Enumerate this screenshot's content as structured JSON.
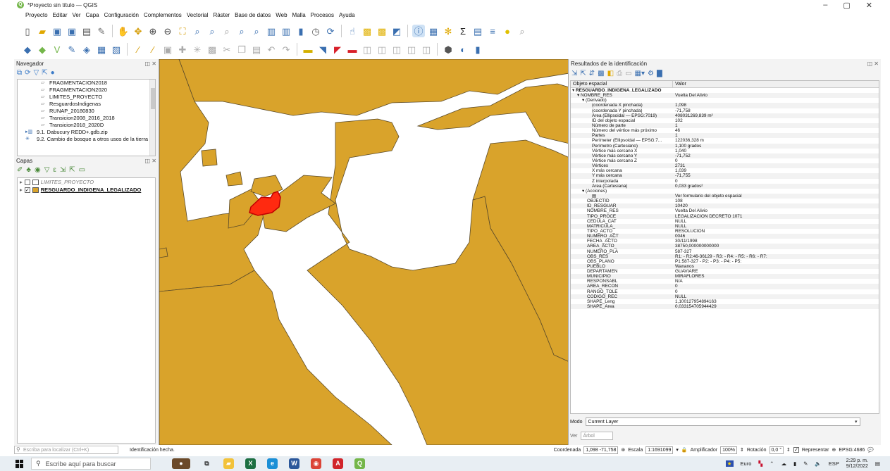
{
  "window": {
    "title": "*Proyecto sin título — QGIS",
    "controls": [
      "–",
      "▢",
      "✕"
    ]
  },
  "menu": [
    "Proyecto",
    "Editar",
    "Ver",
    "Capa",
    "Configuración",
    "Complementos",
    "Vectorial",
    "Ráster",
    "Base de datos",
    "Web",
    "Malla",
    "Procesos",
    "Ayuda"
  ],
  "navigator": {
    "title": "Navegador",
    "items": [
      {
        "label": "FRAGMENTACION2018",
        "indent": 3,
        "icon": "vector-layer-icon"
      },
      {
        "label": "FRAGMENTACION2020",
        "indent": 3,
        "icon": "vector-layer-icon"
      },
      {
        "label": "LIMITES_PROYECTO",
        "indent": 3,
        "icon": "vector-layer-icon"
      },
      {
        "label": "ResguardosIndigenas",
        "indent": 3,
        "icon": "vector-layer-icon"
      },
      {
        "label": "RUNAP_20180830",
        "indent": 3,
        "icon": "vector-layer-icon"
      },
      {
        "label": "Transicion2008_2016_2018",
        "indent": 3,
        "icon": "vector-layer-icon"
      },
      {
        "label": "Transicion2018_2020D",
        "indent": 3,
        "icon": "vector-layer-icon"
      },
      {
        "label": "9.1. Dabucury REDD+.gdb.zip",
        "indent": 1,
        "icon": "zip-icon"
      },
      {
        "label": "9.2. Cambio de bosque a otros usos de la tierra",
        "indent": 1,
        "icon": "folder-icon"
      }
    ]
  },
  "layers": {
    "title": "Capas",
    "items": [
      {
        "label": "LIMITES_PROYECTO",
        "checked": false,
        "italic": true,
        "swatch": "#ffffff"
      },
      {
        "label": "RESGUARDO_INDIGENA_LEGALIZADO",
        "checked": true,
        "italic": false,
        "swatch": "#d9a32b"
      }
    ]
  },
  "map": {
    "fill": "#d9a32b",
    "stroke": "#5a4a2a",
    "highlight": "#ff2a10"
  },
  "results": {
    "title": "Resultados de la identificación",
    "col_feature": "Objeto espacial",
    "col_value": "Valor",
    "rows": [
      {
        "k": "▾ RESGUARDO_INDIGENA_LEGALIZADO",
        "v": "",
        "indent": 0,
        "bold": true
      },
      {
        "k": "▾ NOMBRE_RES",
        "v": "Vuelta Del Alivio",
        "indent": 1,
        "bold": false
      },
      {
        "k": "▾ (Derivado)",
        "v": "",
        "indent": 2,
        "bold": false
      },
      {
        "k": "(coordenada X pinchada)",
        "v": "1,098",
        "indent": 4,
        "bold": false
      },
      {
        "k": "(coordenada Y pinchada)",
        "v": "-71,758",
        "indent": 4,
        "bold": false
      },
      {
        "k": "Área (Ellipsoidal — EPSG:7019)",
        "v": "408031269,839 m²",
        "indent": 4,
        "bold": false
      },
      {
        "k": "ID del objeto espacial",
        "v": "102",
        "indent": 4,
        "bold": false
      },
      {
        "k": "Número de parte",
        "v": "1",
        "indent": 4,
        "bold": false
      },
      {
        "k": "Número del vértice más próximo",
        "v": "46",
        "indent": 4,
        "bold": false
      },
      {
        "k": "Partes",
        "v": "1",
        "indent": 4,
        "bold": false
      },
      {
        "k": "Perímeter (Ellipsoidal — EPSG:7...",
        "v": "122036,328 m",
        "indent": 4,
        "bold": false
      },
      {
        "k": "Perímetro (Cartesiano)",
        "v": "1,100 grados",
        "indent": 4,
        "bold": false
      },
      {
        "k": "Vértice más cercano X",
        "v": "1,040",
        "indent": 4,
        "bold": false
      },
      {
        "k": "Vértice más cercano Y",
        "v": "-71,752",
        "indent": 4,
        "bold": false
      },
      {
        "k": "Vértice más cercano Z",
        "v": "0",
        "indent": 4,
        "bold": false
      },
      {
        "k": "Vértices",
        "v": "2731",
        "indent": 4,
        "bold": false
      },
      {
        "k": "X más cercana",
        "v": "1,039",
        "indent": 4,
        "bold": false
      },
      {
        "k": "Y más cercana",
        "v": "-71,755",
        "indent": 4,
        "bold": false
      },
      {
        "k": "Z interpolada",
        "v": "0",
        "indent": 4,
        "bold": false
      },
      {
        "k": "Área (Cartesiana)",
        "v": "0,033 grados²",
        "indent": 4,
        "bold": false
      },
      {
        "k": "▾ (Acciones)",
        "v": "",
        "indent": 2,
        "bold": false
      },
      {
        "k": "▤",
        "v": "Ver formulario del objeto espacial",
        "indent": 4,
        "bold": false
      },
      {
        "k": "OBJECTID",
        "v": "108",
        "indent": 3,
        "bold": false
      },
      {
        "k": "ID_RESGUAR",
        "v": "10420",
        "indent": 3,
        "bold": false
      },
      {
        "k": "NOMBRE_RES",
        "v": "Vuelta Del Alivio",
        "indent": 3,
        "bold": false
      },
      {
        "k": "TIPO_PROCE",
        "v": "LEGALIZACIÓN DECRETO 1071",
        "indent": 3,
        "bold": false
      },
      {
        "k": "CEDULA_CAT",
        "v": "NULL",
        "indent": 3,
        "bold": false
      },
      {
        "k": "MATRICULA_",
        "v": "NULL",
        "indent": 3,
        "bold": false
      },
      {
        "k": "TIPO_ACTO_",
        "v": "RESOLUCIÓN",
        "indent": 3,
        "bold": false
      },
      {
        "k": "NUMERO_ACT",
        "v": "0046",
        "indent": 3,
        "bold": false
      },
      {
        "k": "FECHA_ACTO",
        "v": "30/11/1998",
        "indent": 3,
        "bold": false
      },
      {
        "k": "AREA_ACTO_",
        "v": "38750,000000000000",
        "indent": 3,
        "bold": false
      },
      {
        "k": "NUMERO_PLA",
        "v": "587-327",
        "indent": 3,
        "bold": false
      },
      {
        "k": "OBS_RES",
        "v": "R1: - R2:46-36129 - R3: - R4: - R5: - R6: - R7:",
        "indent": 3,
        "bold": false
      },
      {
        "k": "OBS_PLANO",
        "v": "P1:587-327 - P2: - P3: - P4: - P5:",
        "indent": 3,
        "bold": false
      },
      {
        "k": "PUEBLO",
        "v": "Wananos",
        "indent": 3,
        "bold": false
      },
      {
        "k": "DEPARTAMEN",
        "v": "GUAVIARE",
        "indent": 3,
        "bold": false
      },
      {
        "k": "MUNICIPIO",
        "v": "MIRAFLORES",
        "indent": 3,
        "bold": false
      },
      {
        "k": "RESPONSABL",
        "v": "N/A",
        "indent": 3,
        "bold": false
      },
      {
        "k": "AREA_RECON",
        "v": "0",
        "indent": 3,
        "bold": false
      },
      {
        "k": "RANGO_TOLE",
        "v": "0",
        "indent": 3,
        "bold": false
      },
      {
        "k": "CODIGO_REC",
        "v": "NULL",
        "indent": 3,
        "bold": false
      },
      {
        "k": "SHAPE_Leng",
        "v": "1,100127954894163",
        "indent": 3,
        "bold": false
      },
      {
        "k": "SHAPE_Area",
        "v": "0,033154705944429",
        "indent": 3,
        "bold": false
      }
    ],
    "modo_label": "Modo",
    "modo_value": "Current Layer",
    "ver_label": "Ver",
    "ver_value": "Árbol"
  },
  "status": {
    "locate_placeholder": "Escriba para localizar (Ctrl+K)",
    "message": "Identificación hecha.",
    "coord_label": "Coordenada",
    "coord_value": "1,098 -71,758",
    "scale_label": "Escala",
    "scale_value": "1:1691099",
    "magnifier_label": "Amplificador",
    "magnifier_value": "100%",
    "rotation_label": "Rotación",
    "rotation_value": "0,0 °",
    "render_label": "Representar",
    "crs": "EPSG:4686"
  },
  "taskbar": {
    "search_placeholder": "Escribe aquí para buscar",
    "currency": "Euro",
    "lang": "ESP",
    "time": "2:29 p. m.",
    "date": "9/12/2022"
  }
}
